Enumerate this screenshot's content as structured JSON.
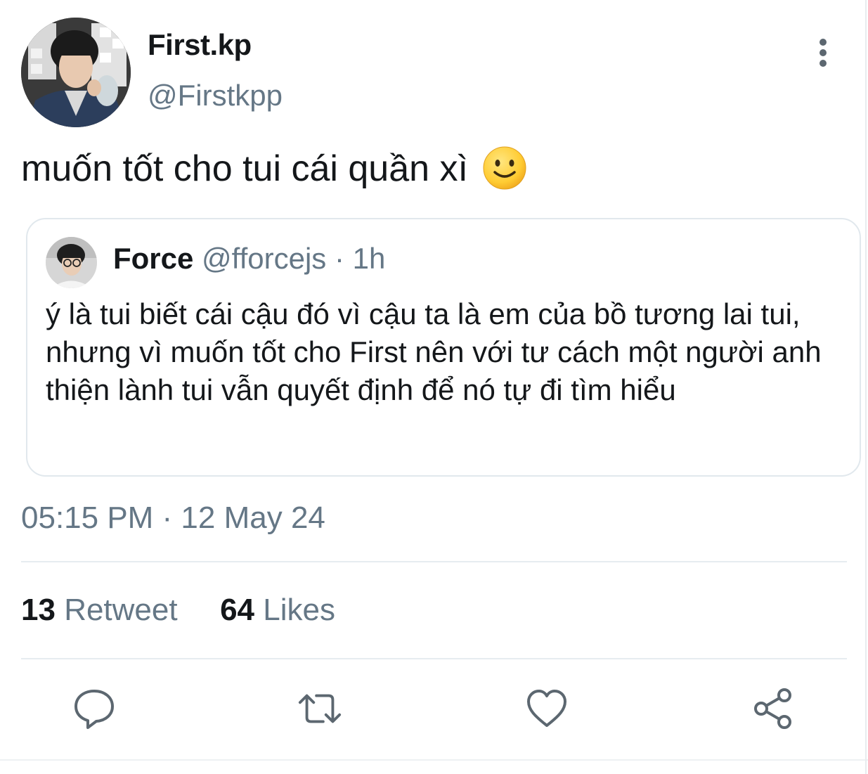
{
  "tweet": {
    "display_name": "First.kp",
    "handle": "@Firstkpp",
    "text": "muốn tốt cho tui cái quần xì",
    "emoji_icon": "slightly-smiling-face-icon",
    "timestamp": "05:15 PM · 12 May 24"
  },
  "quoted_tweet": {
    "display_name": "Force",
    "handle": "@fforcejs",
    "separator": "·",
    "age": "1h",
    "text": "ý là tui biết cái cậu đó vì cậu ta là em của bồ tương lai tui, nhưng vì muốn tốt cho First nên với tư cách một người anh thiện lành tui vẫn quyết định để nó tự đi tìm hiểu"
  },
  "stats": {
    "retweet_count": "13",
    "retweet_label": "Retweet",
    "likes_count": "64",
    "likes_label": "Likes"
  },
  "actions": {
    "reply_icon": "reply-icon",
    "retweet_icon": "retweet-icon",
    "like_icon": "heart-icon",
    "share_icon": "share-icon"
  },
  "colors": {
    "text_primary": "#14171a",
    "text_secondary": "#657786",
    "border": "#e1e8ed",
    "emoji_yellow": "#ffcc33"
  }
}
